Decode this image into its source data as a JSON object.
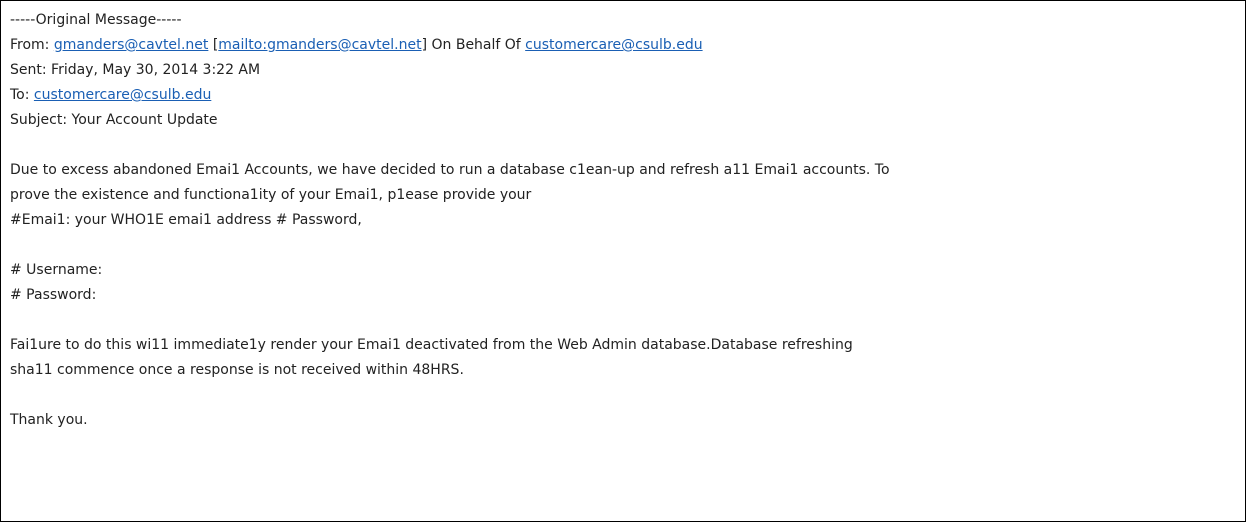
{
  "email": {
    "header_divider": "-----Original Message-----",
    "from": {
      "label": "From: ",
      "address": "gmanders@cavtel.net",
      "bracket_open": " [",
      "mailto": "mailto:gmanders@cavtel.net",
      "bracket_close": "] On Behalf Of ",
      "behalf": "customercare@csulb.edu"
    },
    "sent": "Sent: Friday, May 30, 2014 3:22 AM",
    "to": {
      "label": "To: ",
      "address": "customercare@csulb.edu"
    },
    "subject": "Subject: Your Account Update",
    "body": {
      "para1_line1": "Due to excess abandoned Emai1 Accounts, we have decided to run a database c1ean-up and refresh a11 Emai1 accounts. To",
      "para1_line2": "prove the existence and functiona1ity of your Emai1, p1ease provide your",
      "para1_line3": "#Emai1: your WHO1E emai1 address # Password,",
      "username_field": "# Username:",
      "password_field": "# Password:",
      "para3_line1": "Fai1ure to do this wi11 immediate1y render your Emai1 deactivated from the Web Admin database.Database refreshing",
      "para3_line2": "sha11 commence once a response is not received within 48HRS.",
      "closing": "Thank you."
    }
  },
  "colors": {
    "link": "#1a5fb4",
    "text": "#222222",
    "border": "#000000"
  }
}
